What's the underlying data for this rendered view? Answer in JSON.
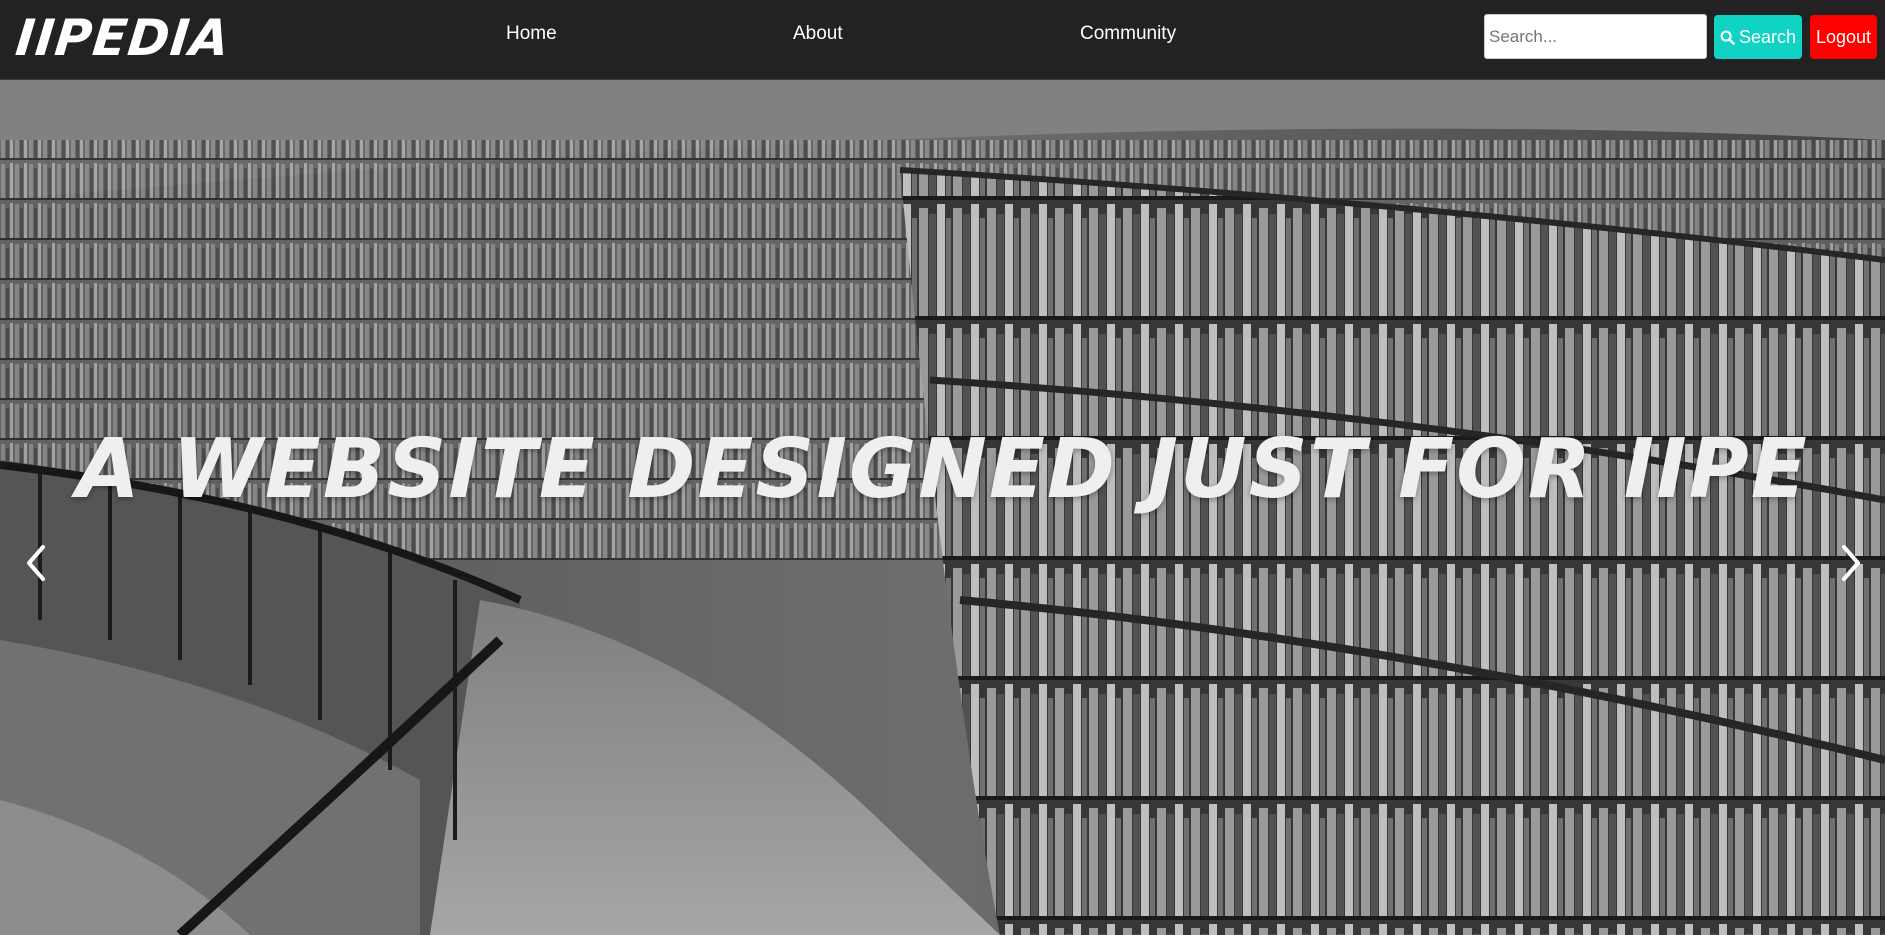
{
  "navbar": {
    "brand": "IIPEDIA",
    "links": [
      {
        "label": "Home"
      },
      {
        "label": "About"
      },
      {
        "label": "Community"
      }
    ],
    "search": {
      "value": "",
      "placeholder": "Search...",
      "button_label": "Search",
      "button_icon": "search-icon",
      "button_color": "#10d3c4"
    },
    "logout": {
      "label": "Logout",
      "color": "#ff0000"
    },
    "background_color": "#222222"
  },
  "hero": {
    "caption": "A WEBSITE DESIGNED JUST FOR IIPE",
    "background": "grayscale photo of curved library bookshelves",
    "prev_icon": "chevron-left-icon",
    "next_icon": "chevron-right-icon"
  }
}
